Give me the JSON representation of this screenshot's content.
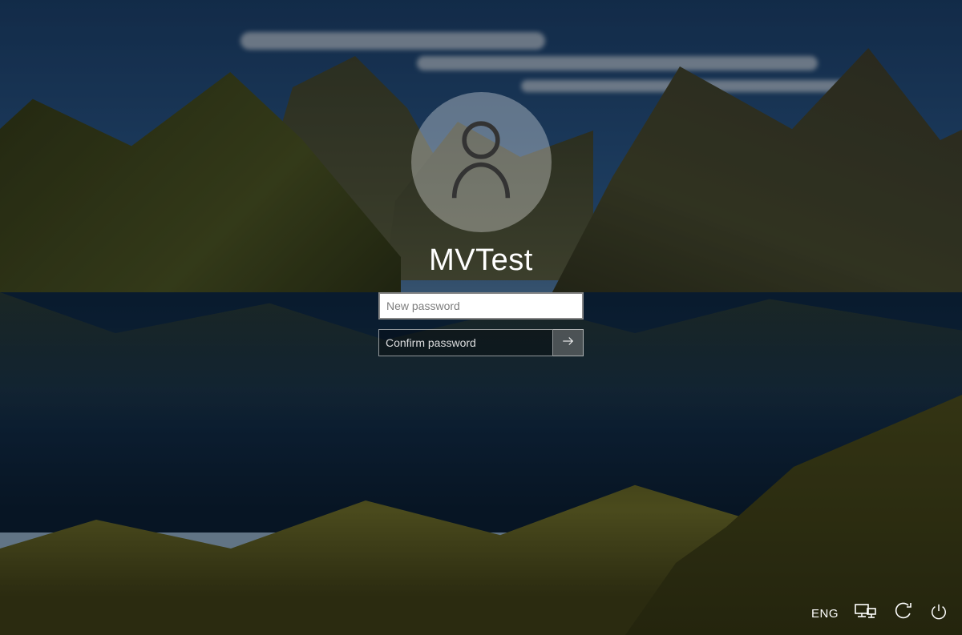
{
  "login": {
    "username": "MVTest",
    "new_password_placeholder": "New password",
    "confirm_password_placeholder": "Confirm password"
  },
  "tray": {
    "language": "ENG"
  }
}
